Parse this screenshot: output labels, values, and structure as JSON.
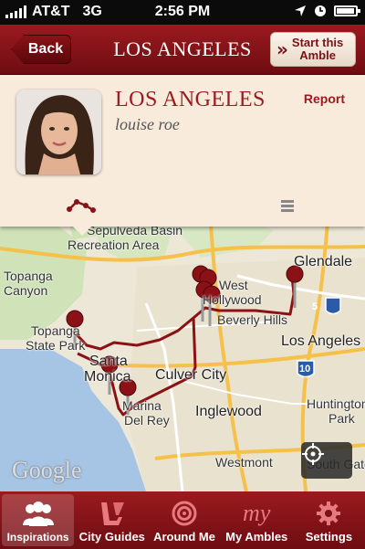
{
  "status_bar": {
    "carrier": "AT&T",
    "network": "3G",
    "time": "2:56 PM"
  },
  "nav": {
    "back_label": "Back",
    "title": "LOS ANGELES",
    "start_label_line1": "Start this",
    "start_label_line2": "Amble"
  },
  "card": {
    "title": "LOS ANGELES",
    "user": "louise roe",
    "report_label": "Report",
    "view_icons": [
      "route-icon",
      "list-icon"
    ]
  },
  "map": {
    "labels": {
      "sepulveda_basin": "Sepulveda Basin",
      "recreation_area": "Recreation Area",
      "topanga_canyon_1": "Topanga",
      "topanga_canyon_2": "Canyon",
      "topanga_state_park_1": "Topanga",
      "topanga_state_park_2": "State Park",
      "glendale": "Glendale",
      "west_hollywood_1": "West",
      "west_hollywood_2": "Hollywood",
      "beverly_hills": "Beverly Hills",
      "los_angeles": "Los Angeles",
      "santa_monica_1": "Santa",
      "santa_monica_2": "Monica",
      "culver_city": "Culver City",
      "marina_del_rey_1": "Marina",
      "marina_del_rey_2": "Del Rey",
      "inglewood": "Inglewood",
      "westmont": "Westmont",
      "south_gate": "South Gate",
      "huntington_park_1": "Huntington",
      "huntington_park_2": "Park",
      "highway_5": "5",
      "highway_10": "10"
    },
    "attribution": "Google",
    "accent_color": "#8b1117"
  },
  "tabs": [
    {
      "label": "Inspirations",
      "icon": "people-icon",
      "active": true
    },
    {
      "label": "City Guides",
      "icon": "lv-monogram-icon",
      "active": false
    },
    {
      "label": "Around Me",
      "icon": "target-icon",
      "active": false
    },
    {
      "label": "My Ambles",
      "icon_text": "my",
      "icon": "my-ambles-icon",
      "active": false
    },
    {
      "label": "Settings",
      "icon": "gear-icon",
      "active": false
    }
  ]
}
